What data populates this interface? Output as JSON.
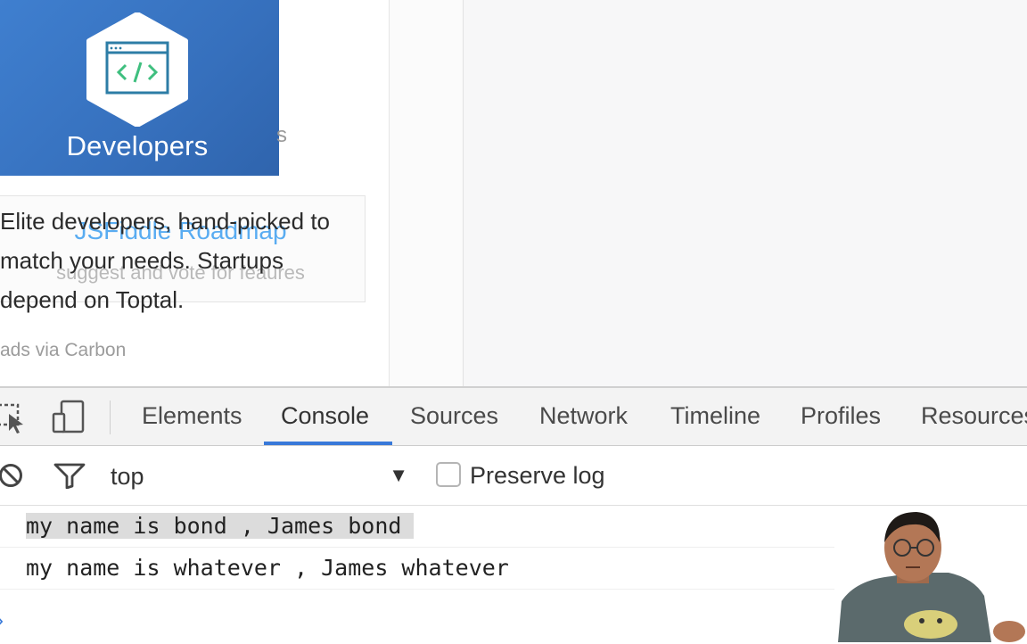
{
  "page": {
    "ad": {
      "brand": "Developers",
      "text_lines": [
        "Elite developers, hand-picked to",
        "match your needs. Startups",
        "depend on Toptal."
      ],
      "attribution": "ads via Carbon"
    },
    "roadmap": {
      "title": "JSFiddle Roadmap",
      "subtitle": "suggest and vote for feaures"
    },
    "stray_char": "s"
  },
  "devtools": {
    "tabs": [
      {
        "label": "Elements",
        "active": false
      },
      {
        "label": "Console",
        "active": true
      },
      {
        "label": "Sources",
        "active": false
      },
      {
        "label": "Network",
        "active": false
      },
      {
        "label": "Timeline",
        "active": false
      },
      {
        "label": "Profiles",
        "active": false
      },
      {
        "label": "Resources",
        "active": false
      }
    ],
    "icons": {
      "inspect": "inspect-element-icon",
      "device": "device-mode-icon",
      "clear": "clear-console-icon",
      "filter": "filter-icon",
      "prompt": "console-prompt-icon"
    },
    "filter": {
      "context": "top",
      "caret": "▼",
      "preserve_log_label": "Preserve log",
      "preserve_log_checked": false
    },
    "console": {
      "messages": [
        "my name is bond , James bond",
        "my name is whatever , James whatever"
      ],
      "prompt_glyph": "›"
    },
    "accent_color": "#3879d9"
  }
}
